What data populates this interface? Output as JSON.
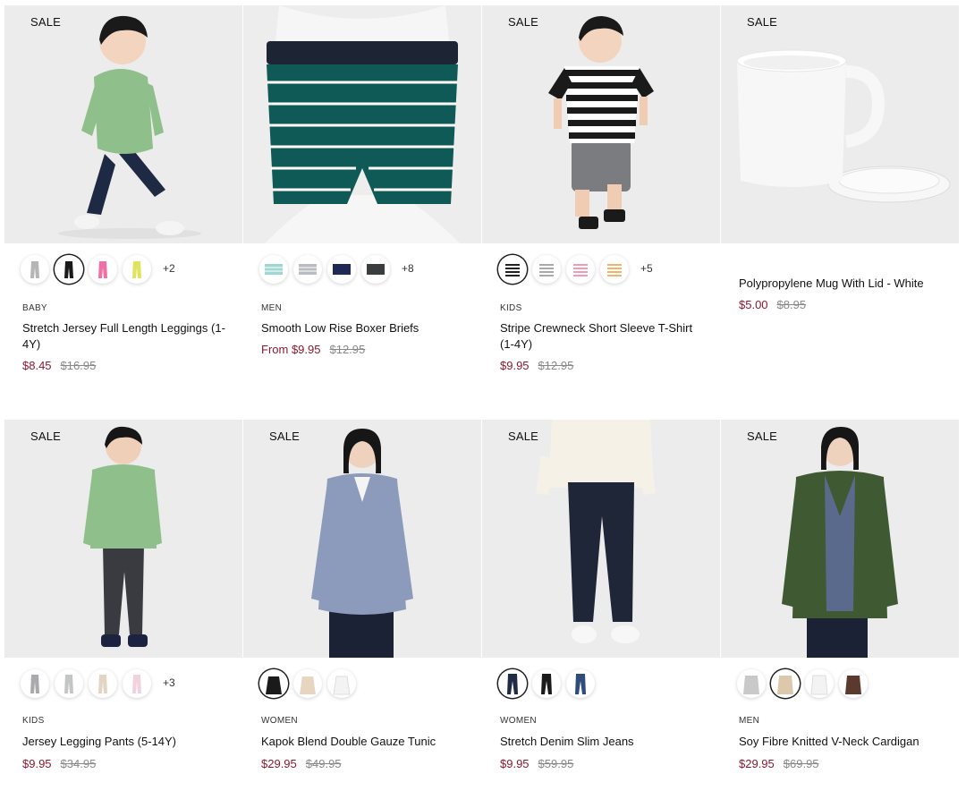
{
  "colors": {
    "sale_price": "#8a1830",
    "original_price": "#888888",
    "image_bg": "#efefef"
  },
  "products": [
    {
      "badge": "SALE",
      "category": "BABY",
      "title": "Stretch Jersey Full Length Leggings (1-4Y)",
      "price": "$8.45",
      "original_price": "$16.95",
      "more_colors": "+2",
      "swatches": [
        "light gray leggings",
        "black leggings",
        "pink leggings",
        "yellow leggings"
      ],
      "selected_swatch": 1
    },
    {
      "badge": "",
      "category": "MEN",
      "title": "Smooth Low Rise Boxer Briefs",
      "price": "From $9.95",
      "original_price": "$12.95",
      "more_colors": "+8",
      "swatches": [
        "mint stripe briefs",
        "gray stripe briefs",
        "navy briefs",
        "charcoal briefs"
      ],
      "selected_swatch": -1
    },
    {
      "badge": "SALE",
      "category": "KIDS",
      "title": "Stripe Crewneck Short Sleeve T-Shirt (1-4Y)",
      "price": "$9.95",
      "original_price": "$12.95",
      "more_colors": "+5",
      "swatches": [
        "black stripe tee",
        "gray stripe tee",
        "pink stripe tee",
        "orange stripe tee"
      ],
      "selected_swatch": 0
    },
    {
      "badge": "SALE",
      "category": "",
      "title": "Polypropylene Mug With Lid - White",
      "price": "$5.00",
      "original_price": "$8.95",
      "more_colors": "",
      "swatches": [],
      "selected_swatch": -1
    },
    {
      "badge": "SALE",
      "category": "KIDS",
      "title": "Jersey Legging Pants (5-14Y)",
      "price": "$9.95",
      "original_price": "$34.95",
      "more_colors": "+3",
      "swatches": [
        "gray pants",
        "light gray pants",
        "beige pants",
        "pink pants"
      ],
      "selected_swatch": -1
    },
    {
      "badge": "SALE",
      "category": "WOMEN",
      "title": "Kapok Blend Double Gauze Tunic",
      "price": "$29.95",
      "original_price": "$49.95",
      "more_colors": "",
      "swatches": [
        "black tunic",
        "beige tunic",
        "white tunic"
      ],
      "selected_swatch": 0
    },
    {
      "badge": "SALE",
      "category": "WOMEN",
      "title": "Stretch Denim Slim Jeans",
      "price": "$9.95",
      "original_price": "$59.95",
      "more_colors": "",
      "swatches": [
        "navy jeans",
        "black jeans",
        "blue jeans"
      ],
      "selected_swatch": 0
    },
    {
      "badge": "SALE",
      "category": "MEN",
      "title": "Soy Fibre Knitted V-Neck Cardigan",
      "price": "$29.95",
      "original_price": "$69.95",
      "more_colors": "",
      "swatches": [
        "light gray cardigan",
        "beige cardigan",
        "white cardigan",
        "brown cardigan"
      ],
      "selected_swatch": 1
    }
  ]
}
